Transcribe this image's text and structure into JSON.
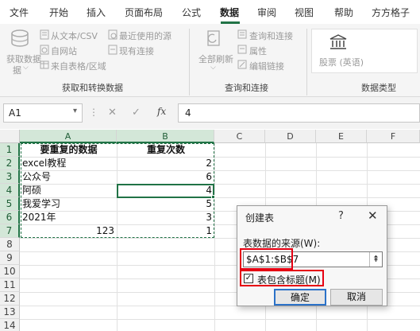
{
  "tabs": [
    "文件",
    "开始",
    "插入",
    "页面布局",
    "公式",
    "数据",
    "审阅",
    "视图",
    "帮助",
    "方方格子"
  ],
  "active_tab": "数据",
  "accent_color": "#217346",
  "ribbon": {
    "get_data": "获取数据",
    "get_data_sub": "据",
    "from_text_csv": "从文本/CSV",
    "from_web": "自网站",
    "from_table": "来自表格/区域",
    "recent_sources": "最近使用的源",
    "existing_connections": "现有连接",
    "group_get_transform": "获取和转换数据",
    "refresh_all": "全部刷新",
    "queries_connections": "查询和连接",
    "properties": "属性",
    "edit_links": "编辑链接",
    "group_queries": "查询和连接",
    "stocks": "股票 (英语)",
    "group_datatypes": "数据类型"
  },
  "formula_bar": {
    "name_box": "A1",
    "formula": "4",
    "fx_label": "fx",
    "cancel_glyph": "✕",
    "enter_glyph": "✓",
    "more_glyph": "⋮"
  },
  "columns": [
    "A",
    "B",
    "C",
    "D",
    "E",
    "F"
  ],
  "rows": [
    "1",
    "2",
    "3",
    "4",
    "5",
    "6",
    "7",
    "8",
    "9",
    "10",
    "11",
    "12",
    "13",
    "14"
  ],
  "sheet": {
    "header_a": "要重复的数据",
    "header_b": "重复次数",
    "a": [
      "excel教程",
      "公众号",
      "阿硕",
      "我爱学习",
      "2021年",
      "123"
    ],
    "b": [
      "2",
      "6",
      "4",
      "5",
      "3",
      "1"
    ]
  },
  "dialog": {
    "title": "创建表",
    "help": "?",
    "close": "✕",
    "source_label": "表数据的来源(W):",
    "range": "$A$1:$B$7",
    "range_button": "⇞",
    "checkbox_checked": "✓",
    "checkbox_label": "表包含标题(M)",
    "ok": "确定",
    "cancel": "取消",
    "highlight_color": "#e60012"
  }
}
